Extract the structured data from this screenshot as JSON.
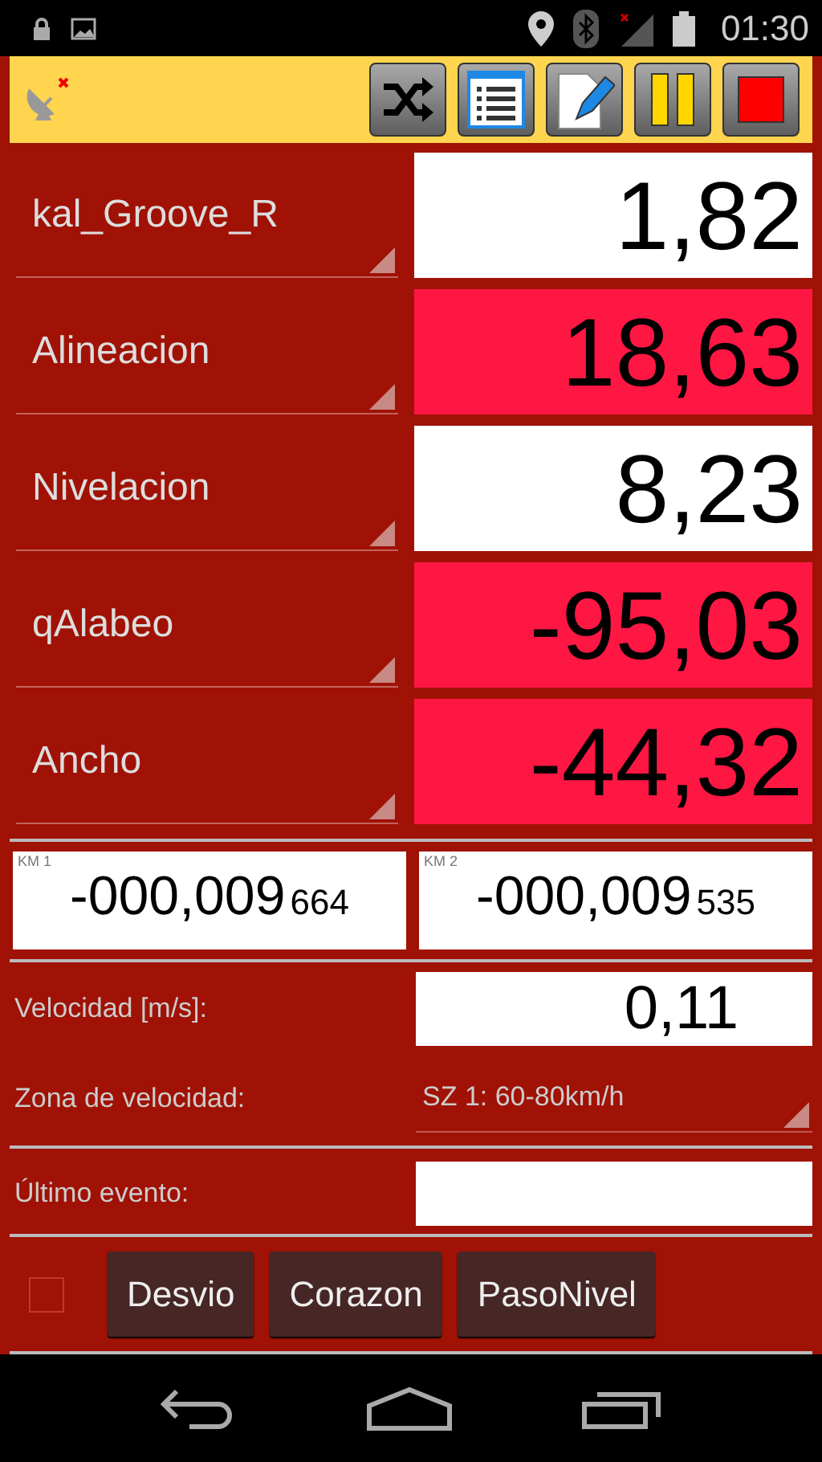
{
  "status_bar": {
    "time": "01:30"
  },
  "measurements": [
    {
      "name": "kal_Groove_R",
      "value": "1,82",
      "alert": false
    },
    {
      "name": "Alineacion",
      "value": "18,63",
      "alert": true
    },
    {
      "name": "Nivelacion",
      "value": "8,23",
      "alert": false
    },
    {
      "name": "qAlabeo",
      "value": "-95,03",
      "alert": true
    },
    {
      "name": "Ancho",
      "value": "-44,32",
      "alert": true
    }
  ],
  "km": [
    {
      "label": "KM 1",
      "value": "-000,009",
      "fraction": "664"
    },
    {
      "label": "KM 2",
      "value": "-000,009",
      "fraction": "535"
    }
  ],
  "speed": {
    "label": "Velocidad [m/s]:",
    "value": "0,11"
  },
  "speed_zone": {
    "label": "Zona de velocidad:",
    "value": "SZ 1: 60-80km/h"
  },
  "last_event": {
    "label": "Último evento:"
  },
  "event_checkbox": {
    "checked": false
  },
  "event_buttons": [
    "Desvio",
    "Corazon",
    "PasoNivel"
  ]
}
